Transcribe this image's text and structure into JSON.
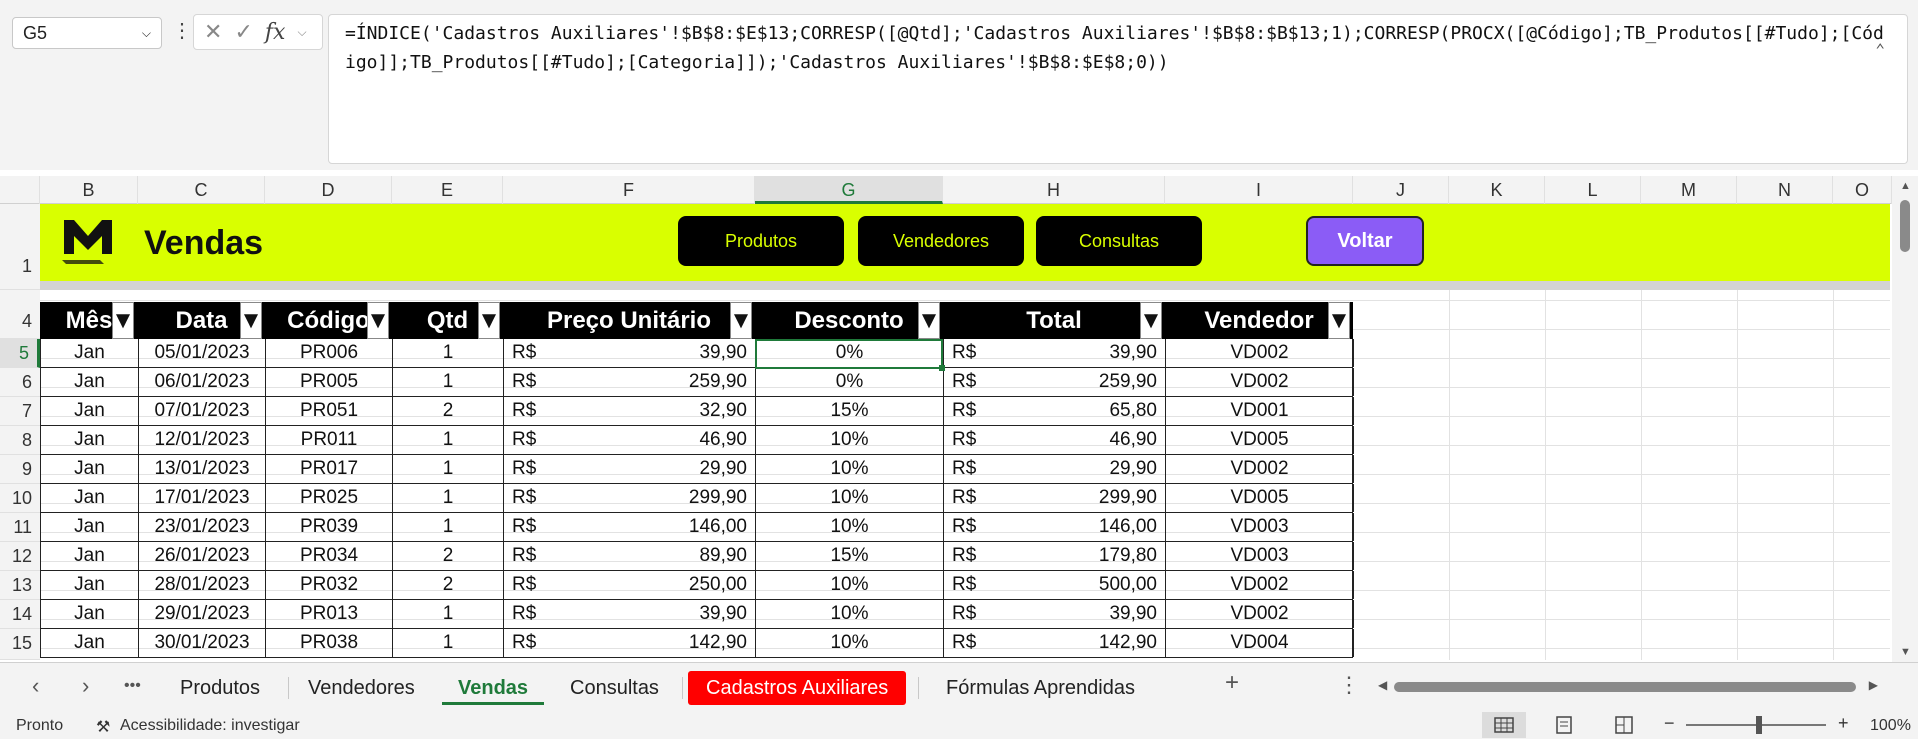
{
  "formula_bar": {
    "name_box": "G5",
    "formula": "=ÍNDICE('Cadastros Auxiliares'!$B$8:$E$13;CORRESP([@Qtd];'Cadastros Auxiliares'!$B$8:$B$13;1);CORRESP(PROCX([@Código];TB_Produtos[[#Tudo];[Código]];TB_Produtos[[#Tudo];[Categoria]]);'Cadastros Auxiliares'!$B$8:$E$8;0))"
  },
  "columns": [
    "B",
    "C",
    "D",
    "E",
    "F",
    "G",
    "H",
    "I",
    "J",
    "K",
    "L",
    "M",
    "N",
    "O"
  ],
  "rows": [
    "1",
    "4",
    "5",
    "6",
    "7",
    "8",
    "9",
    "10",
    "11",
    "12",
    "13",
    "14",
    "15"
  ],
  "banner": {
    "title": "Vendas",
    "buttons": [
      "Produtos",
      "Vendedores",
      "Consultas"
    ],
    "back": "Voltar",
    "colors": {
      "banner": "#d9ff00",
      "button": "#000000",
      "back": "#8b5cf6"
    }
  },
  "table": {
    "headers": [
      "Mês",
      "Data",
      "Código",
      "Qtd",
      "Preço Unitário",
      "Desconto",
      "Total",
      "Vendedor"
    ],
    "currency": "R$",
    "rows": [
      {
        "mes": "Jan",
        "data": "05/01/2023",
        "codigo": "PR006",
        "qtd": "1",
        "preco": "39,90",
        "desconto": "0%",
        "total": "39,90",
        "vendedor": "VD002"
      },
      {
        "mes": "Jan",
        "data": "06/01/2023",
        "codigo": "PR005",
        "qtd": "1",
        "preco": "259,90",
        "desconto": "0%",
        "total": "259,90",
        "vendedor": "VD002"
      },
      {
        "mes": "Jan",
        "data": "07/01/2023",
        "codigo": "PR051",
        "qtd": "2",
        "preco": "32,90",
        "desconto": "15%",
        "total": "65,80",
        "vendedor": "VD001"
      },
      {
        "mes": "Jan",
        "data": "12/01/2023",
        "codigo": "PR011",
        "qtd": "1",
        "preco": "46,90",
        "desconto": "10%",
        "total": "46,90",
        "vendedor": "VD005"
      },
      {
        "mes": "Jan",
        "data": "13/01/2023",
        "codigo": "PR017",
        "qtd": "1",
        "preco": "29,90",
        "desconto": "10%",
        "total": "29,90",
        "vendedor": "VD002"
      },
      {
        "mes": "Jan",
        "data": "17/01/2023",
        "codigo": "PR025",
        "qtd": "1",
        "preco": "299,90",
        "desconto": "10%",
        "total": "299,90",
        "vendedor": "VD005"
      },
      {
        "mes": "Jan",
        "data": "23/01/2023",
        "codigo": "PR039",
        "qtd": "1",
        "preco": "146,00",
        "desconto": "10%",
        "total": "146,00",
        "vendedor": "VD003"
      },
      {
        "mes": "Jan",
        "data": "26/01/2023",
        "codigo": "PR034",
        "qtd": "2",
        "preco": "89,90",
        "desconto": "15%",
        "total": "179,80",
        "vendedor": "VD003"
      },
      {
        "mes": "Jan",
        "data": "28/01/2023",
        "codigo": "PR032",
        "qtd": "2",
        "preco": "250,00",
        "desconto": "10%",
        "total": "500,00",
        "vendedor": "VD002"
      },
      {
        "mes": "Jan",
        "data": "29/01/2023",
        "codigo": "PR013",
        "qtd": "1",
        "preco": "39,90",
        "desconto": "10%",
        "total": "39,90",
        "vendedor": "VD002"
      },
      {
        "mes": "Jan",
        "data": "30/01/2023",
        "codigo": "PR038",
        "qtd": "1",
        "preco": "142,90",
        "desconto": "10%",
        "total": "142,90",
        "vendedor": "VD004"
      }
    ]
  },
  "sheet_tabs": [
    "Produtos",
    "Vendedores",
    "Vendas",
    "Consultas",
    "Cadastros Auxiliares",
    "Fórmulas Aprendidas"
  ],
  "active_tab": "Vendas",
  "tab_more": "•••",
  "add_sheet": "+",
  "status": {
    "ready": "Pronto",
    "accessibility": "Acessibilidade: investigar",
    "zoom": "100%"
  }
}
